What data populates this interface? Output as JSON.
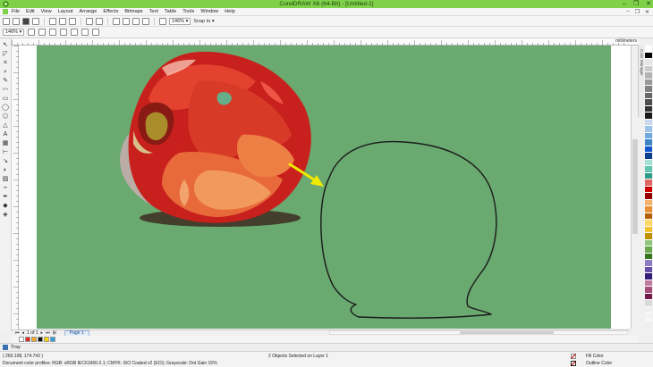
{
  "window": {
    "title": "CorelDRAW X6 (64-Bit) - [Untitled-1]",
    "minimize_glyph": "–",
    "maximize_glyph": "❐",
    "close_glyph": "✕"
  },
  "menu": {
    "items": [
      "File",
      "Edit",
      "View",
      "Layout",
      "Arrange",
      "Effects",
      "Bitmaps",
      "Text",
      "Table",
      "Tools",
      "Window",
      "Help"
    ],
    "right_controls": [
      "–",
      "❐",
      "✕"
    ]
  },
  "toolbar": {
    "zoom_value": "146%",
    "snap_to_label": "Snap to"
  },
  "propbar": {
    "zoom_value": "146%"
  },
  "ruler": {
    "unit_label": "millimeters"
  },
  "docker": {
    "tab_label": "Color Manager"
  },
  "palette": {
    "colors": [
      "#ffffff",
      "#000000",
      "#e6e6e6",
      "#cccccc",
      "#b3b3b3",
      "#999999",
      "#808080",
      "#666666",
      "#4d4d4d",
      "#333333",
      "#1a1a1a",
      "#c8d8ef",
      "#9fc3e8",
      "#6fa8dc",
      "#3d85c6",
      "#1155cc",
      "#0b3d91",
      "#a4e1d5",
      "#63c5b0",
      "#2d9c86",
      "#e06666",
      "#cc0000",
      "#990000",
      "#f6b26b",
      "#e69138",
      "#b45f06",
      "#ffd966",
      "#f1c232",
      "#bf9000",
      "#93c47d",
      "#6aa84f",
      "#38761d",
      "#8e7cc3",
      "#674ea7",
      "#351c75",
      "#c27ba0",
      "#a64d79",
      "#741b47",
      "#d9d9d9",
      "#efefef",
      "#f3f3f3"
    ]
  },
  "pagenav": {
    "page_count_text": "1 of 1",
    "page_tab_label": "Page 1"
  },
  "doc_palette": {
    "colors": [
      "#ffffff",
      "#e0281e",
      "#f5a623",
      "#111111",
      "#f7d900",
      "#2aa1d8"
    ]
  },
  "tray": {
    "label": "Tray"
  },
  "status": {
    "coordinates": "( 260.108, 174.742 )",
    "selection": "2 Objects Selected on Layer 1",
    "color_profiles": "Document color profiles: RGB: sRGB IEC61966-2.1; CMYK: ISO Coated v2 (ECI); Grayscale: Dot Gain 15%",
    "fill_label": "Fill Color",
    "outline_label": "Outline Color"
  },
  "colors": {
    "title_bar": "#7fd14a",
    "page_background": "#6aa96f",
    "arrow": "#f0ea00",
    "apple_red": "#d6382c",
    "outline_stroke": "#1a1a1a"
  }
}
